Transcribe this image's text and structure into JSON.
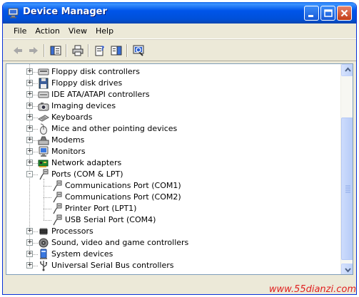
{
  "window": {
    "title": "Device Manager"
  },
  "menu": [
    "File",
    "Action",
    "View",
    "Help"
  ],
  "toolbar_icons": [
    "back-icon",
    "forward-icon",
    "show-hide-tree-icon",
    "print-icon",
    "properties-icon",
    "help-icon",
    "scan-hardware-icon"
  ],
  "tree": [
    {
      "label": "Floppy disk controllers",
      "level": 0,
      "expander": "+",
      "icon": "floppy-controller-icon"
    },
    {
      "label": "Floppy disk drives",
      "level": 0,
      "expander": "+",
      "icon": "floppy-drive-icon"
    },
    {
      "label": "IDE ATA/ATAPI controllers",
      "level": 0,
      "expander": "+",
      "icon": "ide-controller-icon"
    },
    {
      "label": "Imaging devices",
      "level": 0,
      "expander": "+",
      "icon": "imaging-icon"
    },
    {
      "label": "Keyboards",
      "level": 0,
      "expander": "+",
      "icon": "keyboard-icon"
    },
    {
      "label": "Mice and other pointing devices",
      "level": 0,
      "expander": "+",
      "icon": "mouse-icon"
    },
    {
      "label": "Modems",
      "level": 0,
      "expander": "+",
      "icon": "modem-icon"
    },
    {
      "label": "Monitors",
      "level": 0,
      "expander": "+",
      "icon": "monitor-icon"
    },
    {
      "label": "Network adapters",
      "level": 0,
      "expander": "+",
      "icon": "network-adapter-icon"
    },
    {
      "label": "Ports (COM & LPT)",
      "level": 0,
      "expander": "-",
      "icon": "port-icon"
    },
    {
      "label": "Communications Port (COM1)",
      "level": 1,
      "expander": "",
      "icon": "port-icon"
    },
    {
      "label": "Communications Port (COM2)",
      "level": 1,
      "expander": "",
      "icon": "port-icon"
    },
    {
      "label": "Printer Port (LPT1)",
      "level": 1,
      "expander": "",
      "icon": "port-icon"
    },
    {
      "label": "USB Serial Port (COM4)",
      "level": 1,
      "expander": "",
      "icon": "port-icon"
    },
    {
      "label": "Processors",
      "level": 0,
      "expander": "+",
      "icon": "processor-icon"
    },
    {
      "label": "Sound, video and game controllers",
      "level": 0,
      "expander": "+",
      "icon": "sound-icon"
    },
    {
      "label": "System devices",
      "level": 0,
      "expander": "+",
      "icon": "system-device-icon"
    },
    {
      "label": "Universal Serial Bus controllers",
      "level": 0,
      "expander": "+",
      "icon": "usb-icon"
    }
  ],
  "watermark": "www.55dianzi.com",
  "colors": {
    "titlebar": "#0055ea",
    "window_bg": "#ece9d8",
    "watermark": "#e01e1e"
  }
}
